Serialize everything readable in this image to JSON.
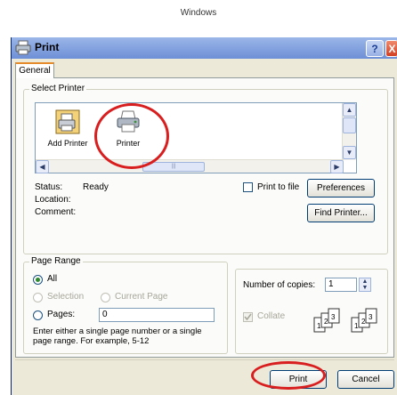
{
  "caption": "Windows",
  "window": {
    "title": "Print",
    "help_glyph": "?",
    "close_glyph": "X"
  },
  "tabs": [
    {
      "label": "General"
    }
  ],
  "select_printer": {
    "legend": "Select Printer",
    "items": [
      {
        "label": "Add Printer",
        "icon": "add-printer-icon"
      },
      {
        "label": "Printer",
        "icon": "printer-icon"
      }
    ],
    "status_label": "Status:",
    "status_value": "Ready",
    "location_label": "Location:",
    "comment_label": "Comment:",
    "print_to_file_label": "Print to file",
    "print_to_file_checked": false,
    "preferences_label": "Preferences",
    "find_printer_label": "Find Printer..."
  },
  "page_range": {
    "legend": "Page Range",
    "all_label": "All",
    "selection_label": "Selection",
    "current_page_label": "Current Page",
    "pages_label": "Pages:",
    "pages_value": "0",
    "hint": "Enter either a single page number or a single page range.  For example, 5-12",
    "selected": "All"
  },
  "copies": {
    "label": "Number of copies:",
    "value": "1",
    "collate_label": "Collate",
    "collate_checked": true,
    "collate_enabled": false
  },
  "buttons": {
    "print_label": "Print",
    "cancel_label": "Cancel"
  },
  "colors": {
    "highlight": "#d81e1e",
    "titlebar": "#6d8fd6",
    "dialog_bg": "#ece9d8"
  }
}
